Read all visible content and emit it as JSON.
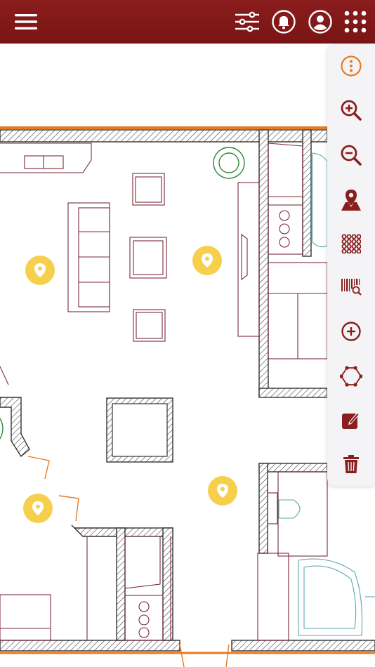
{
  "colors": {
    "header": "#7d1717",
    "accent": "#e87a22",
    "tool": "#8a1d1d",
    "pin": "#f6d04d",
    "wall": "#333333",
    "furniture": "#7a2a3a"
  },
  "header": {
    "menu_icon": "hamburger-menu-icon",
    "filter_icon": "sliders-icon",
    "notifications_icon": "bell-icon",
    "profile_icon": "user-circle-icon",
    "apps_icon": "grid-dots-icon"
  },
  "toolbar": {
    "items": [
      {
        "icon": "more-vertical-icon"
      },
      {
        "icon": "zoom-in-icon"
      },
      {
        "icon": "zoom-out-icon"
      },
      {
        "icon": "map-pin-icon"
      },
      {
        "icon": "grid-dots-icon"
      },
      {
        "icon": "barcode-search-icon"
      },
      {
        "icon": "plus-circle-icon"
      },
      {
        "icon": "polygon-icon"
      },
      {
        "icon": "edit-icon"
      },
      {
        "icon": "trash-icon"
      }
    ]
  },
  "markers": [
    {
      "icon": "location-pin-icon"
    },
    {
      "icon": "location-pin-icon"
    },
    {
      "icon": "location-pin-icon"
    },
    {
      "icon": "location-pin-icon"
    }
  ]
}
